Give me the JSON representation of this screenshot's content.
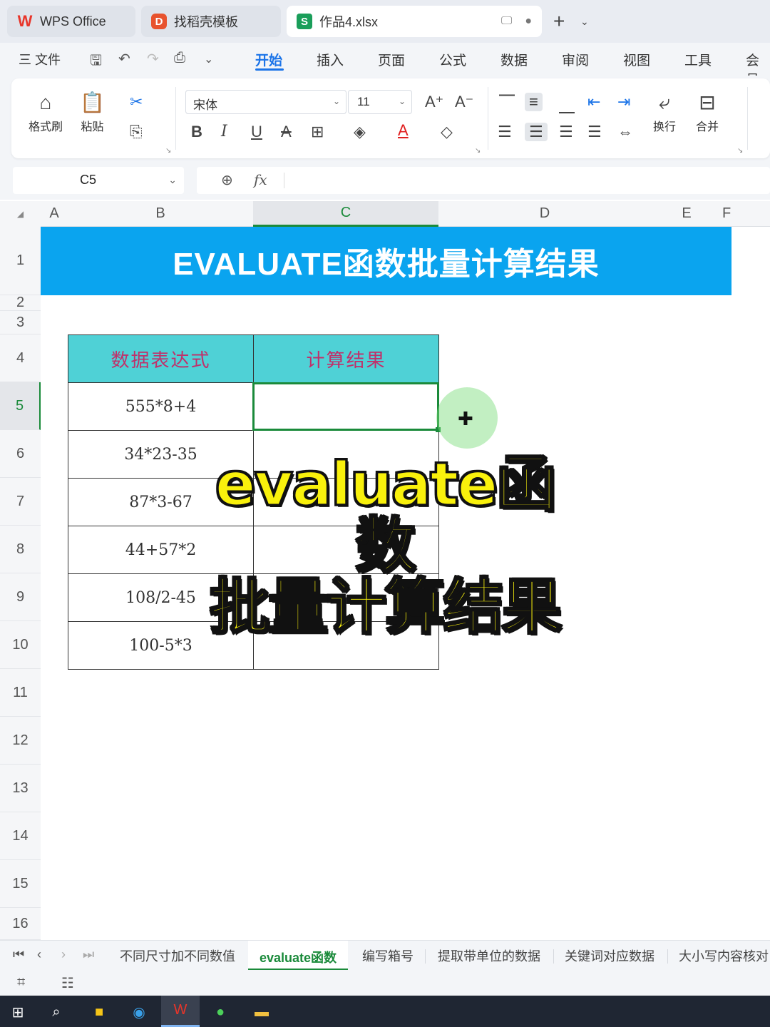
{
  "tabs": {
    "home_label": "WPS Office",
    "template_label": "找稻壳模板",
    "file_label": "作品4.xlsx",
    "new_tab": "+",
    "new_tab_dropdown": "⌄"
  },
  "menubar": {
    "file": "三 文件",
    "items": [
      "开始",
      "插入",
      "页面",
      "公式",
      "数据",
      "审阅",
      "视图",
      "工具",
      "会员"
    ],
    "active": "开始"
  },
  "ribbon": {
    "format_painter": "格式刷",
    "paste": "粘贴",
    "font_name": "宋体",
    "font_size": "11",
    "wrap_text": "换行",
    "merge": "合并"
  },
  "formula_bar": {
    "cell_ref": "C5",
    "fx": "fx",
    "formula": ""
  },
  "grid": {
    "columns": [
      "A",
      "B",
      "C",
      "D",
      "E",
      "F"
    ],
    "selected_column": "C",
    "rows": [
      "1",
      "2",
      "3",
      "4",
      "5",
      "6",
      "7",
      "8",
      "9",
      "10",
      "11",
      "12",
      "13",
      "14",
      "15",
      "16"
    ],
    "selected_row": "5"
  },
  "sheet": {
    "banner_title": "EVALUATE函数批量计算结果",
    "table_headers": [
      "数据表达式",
      "计算结果"
    ],
    "table_rows": [
      [
        "555*8+4",
        ""
      ],
      [
        "34*23-35",
        ""
      ],
      [
        "87*3-67",
        ""
      ],
      [
        "44+57*2",
        ""
      ],
      [
        "108/2-45",
        ""
      ],
      [
        "100-5*3",
        ""
      ]
    ]
  },
  "overlay": {
    "line1": "evaluate函数",
    "line2": "批量计算结果"
  },
  "sheet_tabs": {
    "items": [
      "不同尺寸加不同数值",
      "evaluate函数",
      "编写箱号",
      "提取带单位的数据",
      "关键词对应数据",
      "大小写内容核对"
    ],
    "active": "evaluate函数"
  },
  "colors": {
    "banner": "#0aa4ef",
    "table_header_bg": "#4fd1d6",
    "table_header_text": "#c0306a",
    "selection": "#1a8a3a",
    "overlay_text": "#f9f10c",
    "accent": "#1a73e8"
  }
}
